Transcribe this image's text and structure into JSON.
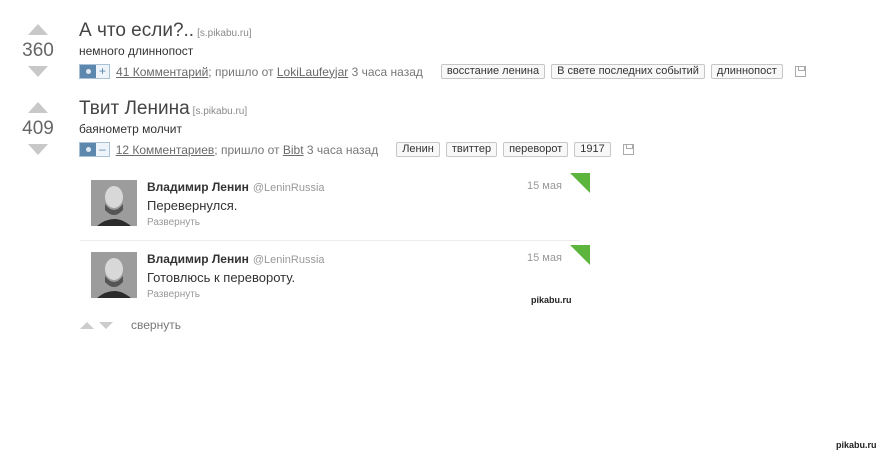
{
  "posts": [
    {
      "rating": "360",
      "title": "А что если?..",
      "source": "[s.pikabu.ru]",
      "description": "немного длиннопост",
      "photo_toggle": "+",
      "comments": "41 Комментарий",
      "from_prefix": "; пришло от",
      "author": "LokiLaufeyjar",
      "time": "3 часа назад",
      "tags": [
        "восстание ленина",
        "В свете последних событий",
        "длиннопост"
      ]
    },
    {
      "rating": "409",
      "title": "Твит Ленина",
      "source": "[s.pikabu.ru]",
      "description": "баянометр молчит",
      "photo_toggle": "–",
      "comments": "12 Комментариев",
      "from_prefix": "; пришло от",
      "author": "Bibt",
      "time": "3 часа назад",
      "tags": [
        "Ленин",
        "твиттер",
        "переворот",
        "1917"
      ]
    }
  ],
  "tweets": [
    {
      "name": "Владимир Ленин",
      "handle": "@LeninRussia",
      "date": "15 мая",
      "text": "Перевернулся.",
      "expand": "Развернуть"
    },
    {
      "name": "Владимир Ленин",
      "handle": "@LeninRussia",
      "date": "15 мая",
      "text": "Готовлюсь к перевороту.",
      "expand": "Развернуть"
    }
  ],
  "watermarks": [
    "pikabu.ru",
    "pikabu.ru"
  ],
  "collapse_label": "свернуть",
  "colors": {
    "twitter_corner": "#5cb63e",
    "link": "#6a6a6a",
    "photo_button": "#5d87ad"
  },
  "icons": [
    "vote-up-icon",
    "vote-down-icon",
    "camera-icon",
    "save-icon",
    "twitter-corner-icon"
  ]
}
